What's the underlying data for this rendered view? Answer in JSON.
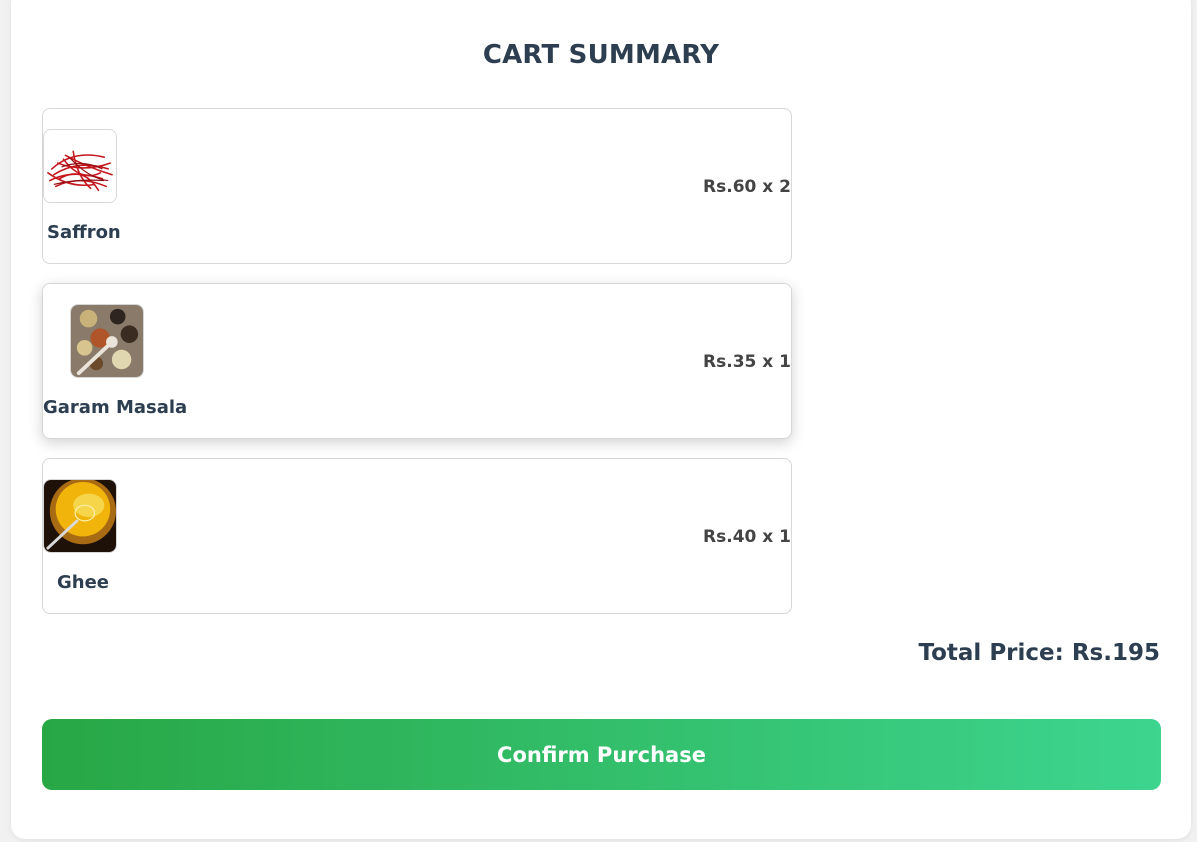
{
  "cart": {
    "title": "CART SUMMARY",
    "items": [
      {
        "name": "Saffron",
        "price_qty": "Rs.60 x 2",
        "icon": "saffron-icon"
      },
      {
        "name": "Garam Masala",
        "price_qty": "Rs.35 x 1",
        "icon": "garam-masala-icon"
      },
      {
        "name": "Ghee",
        "price_qty": "Rs.40 x 1",
        "icon": "ghee-icon"
      }
    ],
    "total_label": "Total Price: Rs.195",
    "confirm_label": "Confirm Purchase"
  },
  "colors": {
    "title": "#2c3e50",
    "button_start": "#28a745",
    "button_end": "#3dd58f"
  }
}
